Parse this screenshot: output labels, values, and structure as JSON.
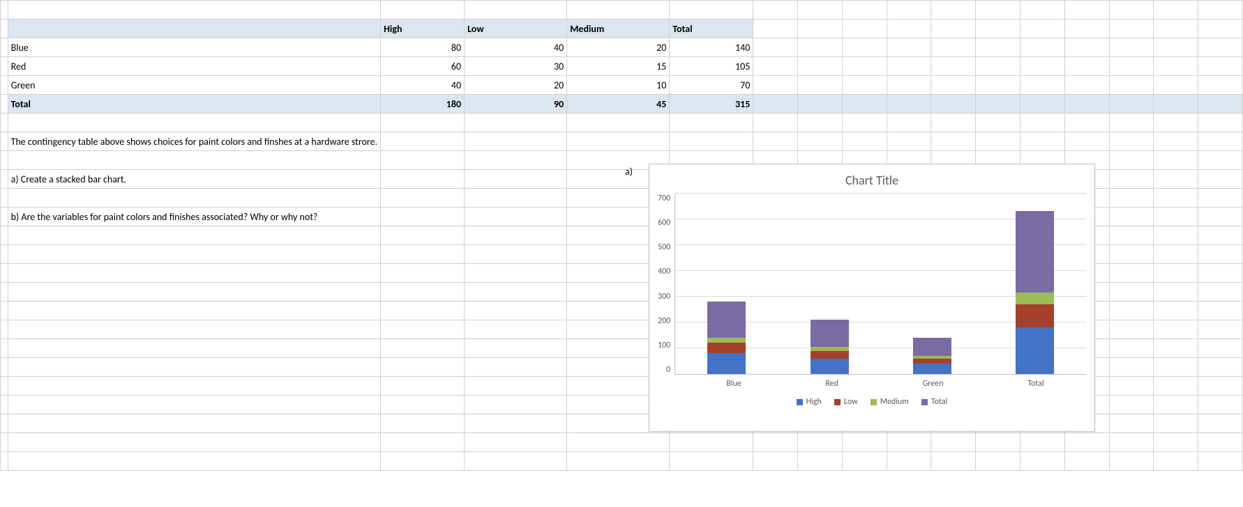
{
  "table": {
    "col_headers": [
      "High",
      "Low",
      "Medium",
      "Total"
    ],
    "rows": [
      {
        "label": "Blue",
        "vals": [
          80,
          40,
          20,
          140
        ]
      },
      {
        "label": "Red",
        "vals": [
          60,
          30,
          15,
          105
        ]
      },
      {
        "label": "Green",
        "vals": [
          40,
          20,
          10,
          70
        ]
      }
    ],
    "total_row": {
      "label": "Total",
      "vals": [
        180,
        90,
        45,
        315
      ]
    }
  },
  "notes": {
    "desc": "The contingency table above shows choices for paint colors and finshes at a hardware strore.",
    "qa": "a) Create a stacked bar chart.",
    "qb": "b) Are the variables for paint colors and finishes associated? Why or why not?",
    "a_marker": "a)"
  },
  "chart_data": {
    "type": "bar",
    "stacked": true,
    "title": "Chart Title",
    "categories": [
      "Blue",
      "Red",
      "Green",
      "Total"
    ],
    "series": [
      {
        "name": "High",
        "color": "#4472c4",
        "values": [
          80,
          60,
          40,
          180
        ]
      },
      {
        "name": "Low",
        "color": "#a5402a",
        "values": [
          40,
          30,
          20,
          90
        ]
      },
      {
        "name": "Medium",
        "color": "#9bbb59",
        "values": [
          20,
          15,
          10,
          45
        ]
      },
      {
        "name": "Total",
        "color": "#7a6ba3",
        "values": [
          140,
          105,
          70,
          315
        ]
      }
    ],
    "y_ticks": [
      0,
      100,
      200,
      300,
      400,
      500,
      600,
      700
    ],
    "ylim": [
      0,
      700
    ],
    "xlabel": "",
    "ylabel": ""
  },
  "grid_cols": [
    12,
    140,
    90,
    170,
    170,
    110,
    110,
    110,
    110,
    110,
    110,
    110,
    110,
    110,
    110,
    110,
    110
  ]
}
